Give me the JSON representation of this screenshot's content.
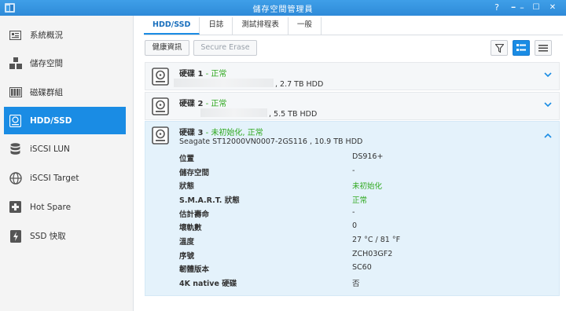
{
  "window": {
    "title": "儲存空間管理員",
    "buttons": {
      "help": "?",
      "pin": "━",
      "minimize": "–",
      "maximize": "☐",
      "close": "✕"
    }
  },
  "sidebar": {
    "items": [
      {
        "label": "系統概況",
        "icon": "overview-icon"
      },
      {
        "label": "儲存空間",
        "icon": "storage-icon"
      },
      {
        "label": "磁碟群組",
        "icon": "disk-group-icon"
      },
      {
        "label": "HDD/SSD",
        "icon": "hdd-icon",
        "active": true
      },
      {
        "label": "iSCSI LUN",
        "icon": "iscsi-lun-icon"
      },
      {
        "label": "iSCSI Target",
        "icon": "iscsi-target-icon"
      },
      {
        "label": "Hot Spare",
        "icon": "hot-spare-icon"
      },
      {
        "label": "SSD 快取",
        "icon": "ssd-cache-icon"
      }
    ]
  },
  "tabs": [
    {
      "label": "HDD/SSD",
      "active": true
    },
    {
      "label": "日誌"
    },
    {
      "label": "測試排程表"
    },
    {
      "label": "一般"
    }
  ],
  "toolbar": {
    "health_info": "健康資訊",
    "secure_erase": "Secure Erase"
  },
  "disks": [
    {
      "name": "硬碟 1",
      "sep": " - ",
      "status": "正常",
      "model": "",
      "info": ", 2.7 TB HDD",
      "expanded": false
    },
    {
      "name": "硬碟 2",
      "sep": " - ",
      "status": "正常",
      "model": "",
      "info": ", 5.5 TB HDD",
      "expanded": false
    },
    {
      "name": "硬碟 3",
      "sep": " - ",
      "status": "未初始化, 正常",
      "model": "Seagate ST12000VN0007-2GS116",
      "info": " , 10.9 TB HDD",
      "expanded": true
    }
  ],
  "details": [
    {
      "label": "位置",
      "value": "DS916+"
    },
    {
      "label": "儲存空間",
      "value": "-"
    },
    {
      "label": "狀態",
      "value": "未初始化",
      "color": "#2ea81e"
    },
    {
      "label": "S.M.A.R.T. 狀態",
      "value": "正常",
      "color": "#2ea81e"
    },
    {
      "label": "估計壽命",
      "value": "-"
    },
    {
      "label": "壞軌數",
      "value": "0"
    },
    {
      "label": "溫度",
      "value": "27 °C / 81 °F"
    },
    {
      "label": "序號",
      "value": "ZCH03GF2"
    },
    {
      "label": "韌體版本",
      "value": "SC60"
    },
    {
      "label": "4K native 硬碟",
      "value": "否"
    }
  ],
  "colors": {
    "accent": "#1a8ce4",
    "ok": "#2ea81e",
    "expanded_bg": "#e4f2fb"
  }
}
